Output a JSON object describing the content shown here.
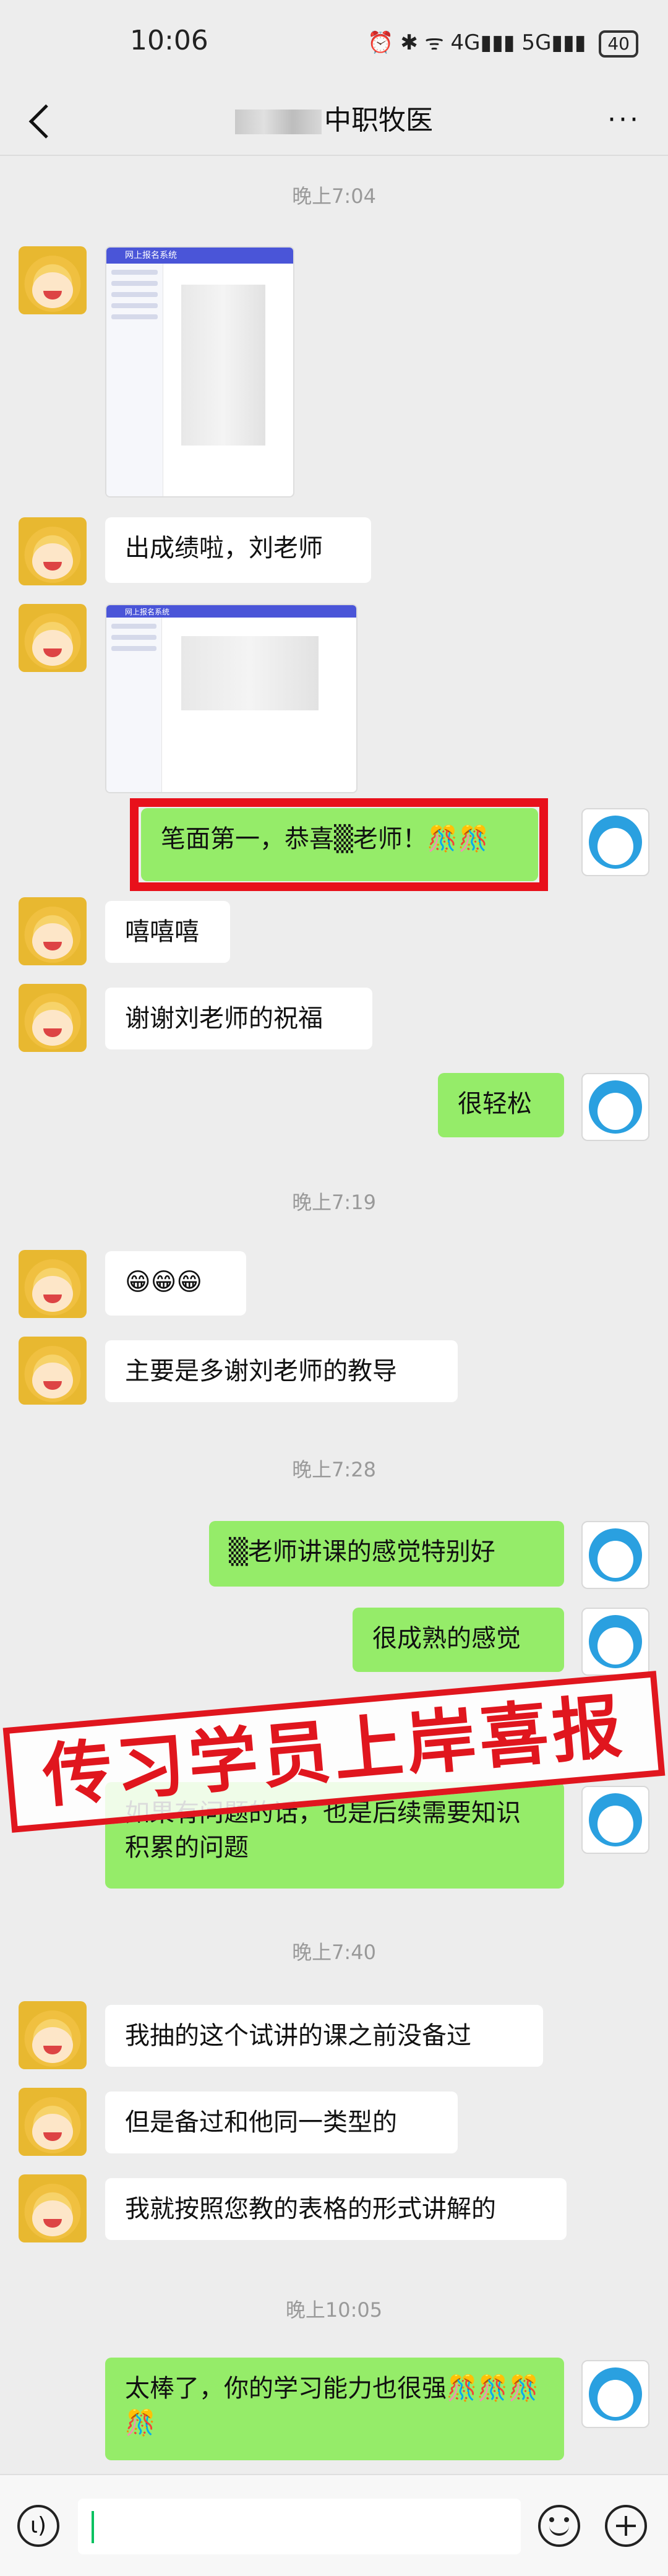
{
  "status": {
    "time": "10:06",
    "icons": "⏰ ✱ ᯤ 4G▮▮▮ 5G▮▮▮",
    "battery": "40"
  },
  "header": {
    "title": "中职牧医"
  },
  "timestamps": [
    "晚上7:04",
    "晚上7:19",
    "晚上7:28",
    "晚上7:40",
    "晚上10:05"
  ],
  "messages": [
    {
      "side": "left",
      "text": "出成绩啦，刘老师"
    },
    {
      "side": "right",
      "text": "笔面第一，恭喜▒老师！🎊🎊"
    },
    {
      "side": "left",
      "text": "嘻嘻嘻"
    },
    {
      "side": "left",
      "text": "谢谢刘老师的祝福"
    },
    {
      "side": "right",
      "text": "很轻松"
    },
    {
      "side": "left",
      "text": "😁😁😁"
    },
    {
      "side": "left",
      "text": "主要是多谢刘老师的教导"
    },
    {
      "side": "right",
      "text": "▒老师讲课的感觉特别好"
    },
    {
      "side": "right",
      "text": "很成熟的感觉"
    },
    {
      "side": "right",
      "text": "如果有问题的话，也是后续需要知识积累的问题"
    },
    {
      "side": "left",
      "text": "我抽的这个试讲的课之前没备过"
    },
    {
      "side": "left",
      "text": "但是备过和他同一类型的"
    },
    {
      "side": "left",
      "text": "我就按照您教的表格的形式讲解的"
    },
    {
      "side": "right",
      "text": "太棒了，你的学习能力也很强🎊🎊🎊🎊"
    }
  ],
  "screenshot_title": "网上报名系统",
  "banner": "传习学员上岸喜报",
  "icons": {
    "back": "chevron-left-icon",
    "more": "more-icon",
    "voice": "voice-icon",
    "emoji": "emoji-icon",
    "add": "plus-icon"
  },
  "colors": {
    "self_bubble": "#95ec69",
    "other_bubble": "#ffffff",
    "banner": "#e0161e",
    "background": "#ededed"
  }
}
